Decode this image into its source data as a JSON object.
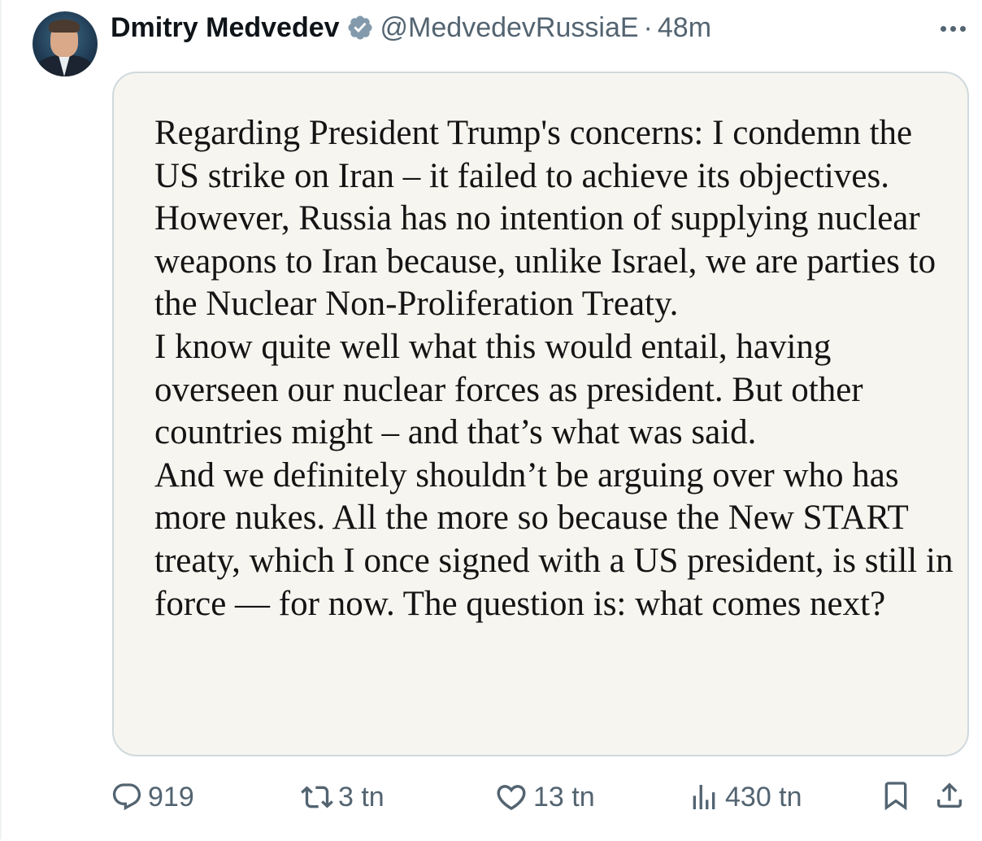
{
  "tweet": {
    "author_name": "Dmitry Medvedev",
    "handle": "@MedvedevRussiaE",
    "separator": "·",
    "time": "48m",
    "image_text": "Regarding President Trump's concerns: I condemn the US strike on Iran – it failed to achieve its objectives. However, Russia has no intention of supplying nuclear weapons to Iran because, unlike Israel, we are parties to the Nuclear Non-Proliferation Treaty.\nI know quite well what this would entail, having overseen our nuclear forces as president. But other countries might – and that’s what was said.\nAnd we definitely shouldn’t be arguing over who has more nukes. All the more so because the New START treaty, which I once signed with a US president, is still in force — for now. The question is: what comes next?"
  },
  "actions": {
    "replies": "919",
    "retweets": "3 tn",
    "likes": "13 tn",
    "views": "430 tn"
  },
  "icons": {
    "verified": "verified-badge-icon",
    "more": "more-dots-icon",
    "reply": "reply-bubble-icon",
    "retweet": "retweet-icon",
    "like": "heart-icon",
    "views": "bar-chart-icon",
    "bookmark": "bookmark-icon",
    "share": "share-icon"
  },
  "colors": {
    "text": "#0f1419",
    "secondary": "#536471",
    "border": "#cfd9de",
    "media_bg": "#f7f5ef"
  }
}
